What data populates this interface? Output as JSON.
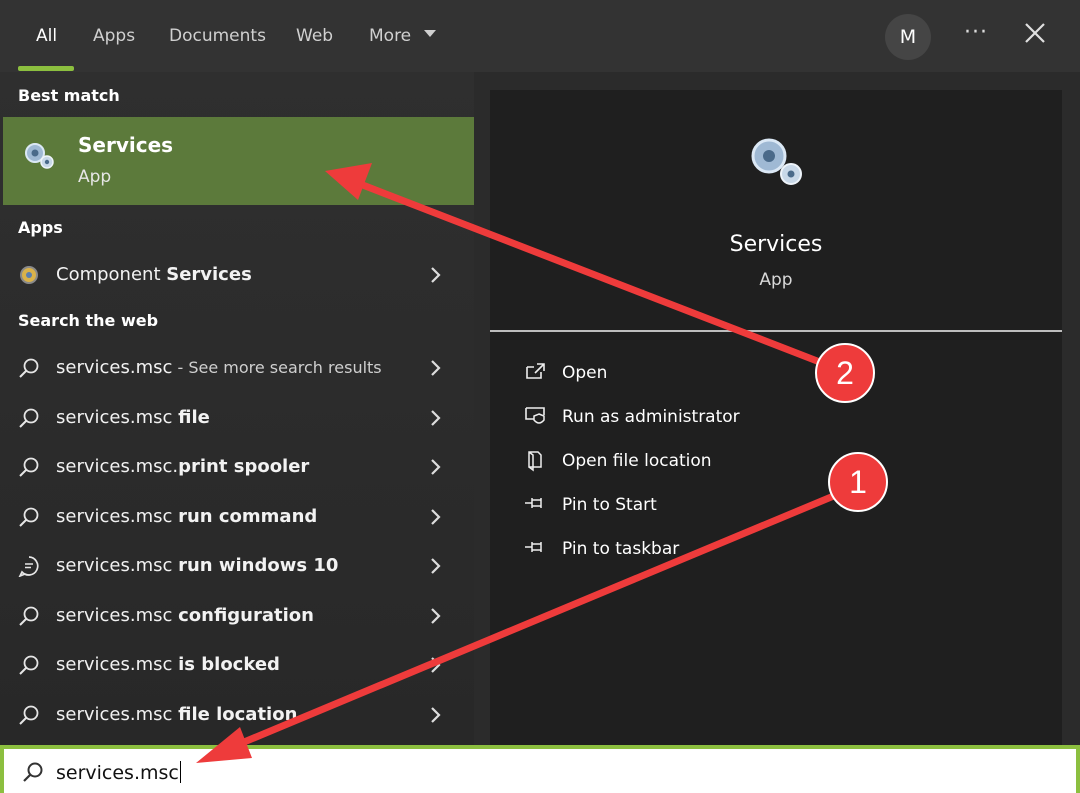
{
  "tabs": [
    {
      "label": "All",
      "active": true
    },
    {
      "label": "Apps"
    },
    {
      "label": "Documents"
    },
    {
      "label": "Web"
    },
    {
      "label": "More"
    }
  ],
  "header": {
    "avatar_initial": "M",
    "more_options": "···"
  },
  "best_match": {
    "header": "Best match",
    "title": "Services",
    "subtitle": "App",
    "icon": "services-gear-icon"
  },
  "apps": {
    "header": "Apps",
    "items": [
      {
        "pre": "Component ",
        "bold": "Services",
        "icon": "component-services-icon"
      }
    ]
  },
  "web": {
    "header": "Search the web",
    "items": [
      {
        "pre": "services.msc",
        "bold": "",
        "dim": " - See more search results",
        "icon": "search-icon"
      },
      {
        "pre": "services.msc ",
        "bold": "file",
        "icon": "search-icon"
      },
      {
        "pre": "services.msc.",
        "bold": "print spooler",
        "icon": "search-icon"
      },
      {
        "pre": "services.msc ",
        "bold": "run command",
        "icon": "search-icon"
      },
      {
        "pre": "services.msc ",
        "bold": "run windows 10",
        "icon": "chat-icon"
      },
      {
        "pre": "services.msc ",
        "bold": "configuration",
        "icon": "search-icon"
      },
      {
        "pre": "services.msc ",
        "bold": "is blocked",
        "icon": "search-icon"
      },
      {
        "pre": "services.msc ",
        "bold": "file location",
        "icon": "search-icon"
      }
    ]
  },
  "preview": {
    "title": "Services",
    "subtitle": "App",
    "actions": [
      {
        "label": "Open",
        "icon": "open-icon"
      },
      {
        "label": "Run as administrator",
        "icon": "shield-icon"
      },
      {
        "label": "Open file location",
        "icon": "folder-icon"
      },
      {
        "label": "Pin to Start",
        "icon": "pin-icon"
      },
      {
        "label": "Pin to taskbar",
        "icon": "pin-icon"
      }
    ]
  },
  "search": {
    "value": "services.msc"
  },
  "annotations": {
    "badge1": "1",
    "badge2": "2"
  },
  "colors": {
    "accent": "#8cbf3f",
    "highlight": "#5c7a3b",
    "annotation": "#ee3b3b"
  }
}
